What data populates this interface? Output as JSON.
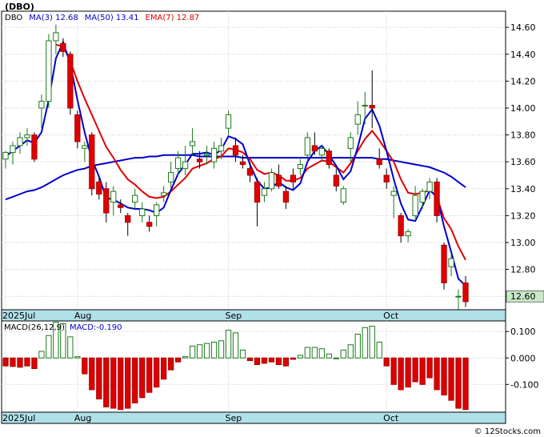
{
  "title": "(DBO)",
  "watermark": "© 12Stocks.com",
  "colors": {
    "up_fill": "#ffffff",
    "up_stroke": "#1a7a1a",
    "down_fill": "#e00000",
    "ma3": "#0000cc",
    "ma50": "#0000cc",
    "ema7": "#dd0000",
    "macd_up": "#ffffff",
    "macd_down": "#dd0000",
    "axis_band": "#b0e0e8",
    "last_tag": "#c8e8c8"
  },
  "chart_data": [
    {
      "type": "candlestick",
      "legend": [
        {
          "label": "DBO",
          "value": ""
        },
        {
          "label": "MA(3)",
          "value": "12.68"
        },
        {
          "label": "MA(50)",
          "value": "13.41"
        },
        {
          "label": "EMA(7)",
          "value": "12.87"
        }
      ],
      "last_price": "12.60",
      "ylim": [
        12.5,
        14.72
      ],
      "yticks": [
        "14.60",
        "14.40",
        "14.20",
        "14.00",
        "13.80",
        "13.60",
        "13.40",
        "13.20",
        "13.00",
        "12.80",
        "12.60"
      ],
      "xticks": [
        {
          "label": "2025Jul",
          "index": 0
        },
        {
          "label": "Aug",
          "index": 10
        },
        {
          "label": "Sep",
          "index": 31
        },
        {
          "label": "Oct",
          "index": 53
        }
      ],
      "grid": true,
      "candles": [
        [
          13.62,
          13.68,
          13.55,
          13.67
        ],
        [
          13.67,
          13.75,
          13.58,
          13.72
        ],
        [
          13.72,
          13.82,
          13.66,
          13.78
        ],
        [
          13.78,
          13.85,
          13.72,
          13.8
        ],
        [
          13.8,
          13.82,
          13.6,
          13.62
        ],
        [
          14.0,
          14.1,
          13.85,
          14.05
        ],
        [
          14.05,
          14.55,
          14.0,
          14.5
        ],
        [
          14.5,
          14.62,
          14.4,
          14.56
        ],
        [
          14.48,
          14.52,
          14.38,
          14.42
        ],
        [
          14.4,
          14.42,
          13.95,
          14.0
        ],
        [
          13.95,
          13.98,
          13.7,
          13.75
        ],
        [
          13.7,
          13.75,
          13.6,
          13.72
        ],
        [
          13.8,
          13.82,
          13.35,
          13.4
        ],
        [
          13.45,
          13.48,
          13.32,
          13.36
        ],
        [
          13.4,
          13.45,
          13.15,
          13.22
        ],
        [
          13.3,
          13.42,
          13.2,
          13.38
        ],
        [
          13.28,
          13.32,
          13.22,
          13.26
        ],
        [
          13.2,
          13.22,
          13.05,
          13.15
        ],
        [
          13.3,
          13.4,
          13.25,
          13.35
        ],
        [
          13.2,
          13.3,
          13.15,
          13.25
        ],
        [
          13.15,
          13.2,
          13.08,
          13.12
        ],
        [
          13.2,
          13.3,
          13.12,
          13.28
        ],
        [
          13.35,
          13.42,
          13.3,
          13.37
        ],
        [
          13.45,
          13.6,
          13.4,
          13.52
        ],
        [
          13.55,
          13.68,
          13.5,
          13.63
        ],
        [
          13.55,
          13.72,
          13.5,
          13.6
        ],
        [
          13.72,
          13.85,
          13.65,
          13.75
        ],
        [
          13.62,
          13.68,
          13.55,
          13.6
        ],
        [
          13.65,
          13.72,
          13.58,
          13.66
        ],
        [
          13.6,
          13.75,
          13.55,
          13.7
        ],
        [
          13.68,
          13.78,
          13.62,
          13.72
        ],
        [
          13.85,
          13.98,
          13.8,
          13.95
        ],
        [
          13.72,
          13.78,
          13.6,
          13.65
        ],
        [
          13.6,
          13.65,
          13.55,
          13.58
        ],
        [
          13.55,
          13.6,
          13.45,
          13.5
        ],
        [
          13.45,
          13.48,
          13.12,
          13.3
        ],
        [
          13.35,
          13.45,
          13.3,
          13.4
        ],
        [
          13.4,
          13.55,
          13.38,
          13.52
        ],
        [
          13.5,
          13.58,
          13.4,
          13.42
        ],
        [
          13.38,
          13.42,
          13.25,
          13.3
        ],
        [
          13.5,
          13.55,
          13.4,
          13.45
        ],
        [
          13.55,
          13.62,
          13.5,
          13.58
        ],
        [
          13.65,
          13.82,
          13.6,
          13.78
        ],
        [
          13.72,
          13.82,
          13.65,
          13.68
        ],
        [
          13.65,
          13.72,
          13.6,
          13.7
        ],
        [
          13.68,
          13.7,
          13.55,
          13.58
        ],
        [
          13.5,
          13.55,
          13.38,
          13.42
        ],
        [
          13.3,
          13.42,
          13.28,
          13.4
        ],
        [
          13.7,
          13.82,
          13.6,
          13.78
        ],
        [
          13.88,
          14.05,
          13.8,
          13.95
        ],
        [
          14.02,
          14.12,
          13.88,
          14.02
        ],
        [
          14.02,
          14.28,
          13.85,
          14.0
        ],
        [
          13.62,
          13.7,
          13.55,
          13.58
        ],
        [
          13.5,
          13.55,
          13.4,
          13.45
        ],
        [
          13.35,
          13.42,
          13.18,
          13.38
        ],
        [
          13.2,
          13.22,
          13.0,
          13.05
        ],
        [
          13.05,
          13.1,
          13.0,
          13.08
        ],
        [
          13.2,
          13.42,
          13.18,
          13.35
        ],
        [
          13.3,
          13.4,
          13.25,
          13.38
        ],
        [
          13.38,
          13.48,
          13.32,
          13.45
        ],
        [
          13.45,
          13.48,
          13.15,
          13.2
        ],
        [
          12.98,
          13.0,
          12.65,
          12.7
        ],
        [
          12.82,
          12.92,
          12.75,
          12.88
        ],
        [
          12.6,
          12.65,
          12.5,
          12.6
        ],
        [
          12.7,
          12.75,
          12.52,
          12.56
        ]
      ],
      "ma3": [
        13.64,
        13.68,
        13.72,
        13.76,
        13.74,
        13.82,
        14.06,
        14.37,
        14.49,
        14.33,
        14.06,
        13.82,
        13.62,
        13.49,
        13.33,
        13.32,
        13.29,
        13.26,
        13.25,
        13.25,
        13.24,
        13.22,
        13.26,
        13.39,
        13.51,
        13.58,
        13.66,
        13.66,
        13.67,
        13.65,
        13.69,
        13.79,
        13.77,
        13.73,
        13.58,
        13.46,
        13.4,
        13.41,
        13.45,
        13.41,
        13.39,
        13.44,
        13.6,
        13.68,
        13.72,
        13.65,
        13.57,
        13.47,
        13.53,
        13.71,
        13.92,
        13.99,
        13.87,
        13.68,
        13.47,
        13.29,
        13.17,
        13.16,
        13.27,
        13.39,
        13.34,
        13.12,
        12.93,
        12.73,
        12.68
      ],
      "ma50": [
        13.32,
        13.34,
        13.36,
        13.38,
        13.39,
        13.41,
        13.44,
        13.47,
        13.5,
        13.52,
        13.54,
        13.55,
        13.57,
        13.58,
        13.59,
        13.6,
        13.61,
        13.62,
        13.63,
        13.63,
        13.64,
        13.64,
        13.65,
        13.65,
        13.65,
        13.65,
        13.65,
        13.64,
        13.64,
        13.64,
        13.64,
        13.64,
        13.64,
        13.63,
        13.63,
        13.63,
        13.63,
        13.63,
        13.63,
        13.63,
        13.63,
        13.63,
        13.63,
        13.63,
        13.63,
        13.63,
        13.63,
        13.63,
        13.63,
        13.63,
        13.63,
        13.63,
        13.62,
        13.62,
        13.61,
        13.6,
        13.59,
        13.58,
        13.57,
        13.56,
        13.54,
        13.52,
        13.49,
        13.45,
        13.41
      ],
      "ema7": [
        null,
        null,
        null,
        null,
        null,
        null,
        null,
        14.47,
        14.46,
        14.35,
        14.2,
        14.07,
        13.95,
        13.83,
        13.71,
        13.63,
        13.54,
        13.47,
        13.43,
        13.38,
        13.34,
        13.33,
        13.34,
        13.38,
        13.43,
        13.48,
        13.55,
        13.57,
        13.59,
        13.62,
        13.64,
        13.7,
        13.69,
        13.67,
        13.62,
        13.54,
        13.51,
        13.52,
        13.5,
        13.46,
        13.46,
        13.48,
        13.55,
        13.58,
        13.61,
        13.6,
        13.56,
        13.52,
        13.59,
        13.68,
        13.77,
        13.83,
        13.76,
        13.68,
        13.6,
        13.47,
        13.37,
        13.36,
        13.37,
        13.39,
        13.34,
        13.18,
        13.1,
        12.97,
        12.87
      ]
    },
    {
      "type": "bar",
      "legend": [
        {
          "label": "MACD(26,12,9)",
          "value": ""
        },
        {
          "label": "MACD:",
          "value": "-0.190"
        }
      ],
      "ylim": [
        -0.205,
        0.14
      ],
      "yticks": [
        "0.100",
        "0.000",
        "-0.100"
      ],
      "xticks": [
        {
          "label": "2025Jul",
          "index": 0
        },
        {
          "label": "Aug",
          "index": 10
        },
        {
          "label": "Sep",
          "index": 31
        },
        {
          "label": "Oct",
          "index": 53
        }
      ],
      "grid": true,
      "values": [
        -0.03,
        -0.032,
        -0.035,
        -0.03,
        -0.04,
        0.025,
        0.085,
        0.135,
        0.13,
        0.08,
        0.005,
        -0.06,
        -0.12,
        -0.155,
        -0.185,
        -0.19,
        -0.195,
        -0.19,
        -0.17,
        -0.15,
        -0.13,
        -0.11,
        -0.08,
        -0.045,
        -0.015,
        0.005,
        0.045,
        0.05,
        0.055,
        0.06,
        0.065,
        0.105,
        0.095,
        0.03,
        -0.01,
        -0.025,
        -0.02,
        -0.015,
        -0.025,
        -0.03,
        -0.005,
        0.01,
        0.04,
        0.04,
        0.035,
        0.015,
        0.0,
        0.03,
        0.05,
        0.09,
        0.115,
        0.12,
        0.06,
        -0.03,
        -0.1,
        -0.12,
        -0.11,
        -0.09,
        -0.1,
        -0.075,
        -0.12,
        -0.14,
        -0.16,
        -0.19,
        -0.195
      ]
    }
  ]
}
